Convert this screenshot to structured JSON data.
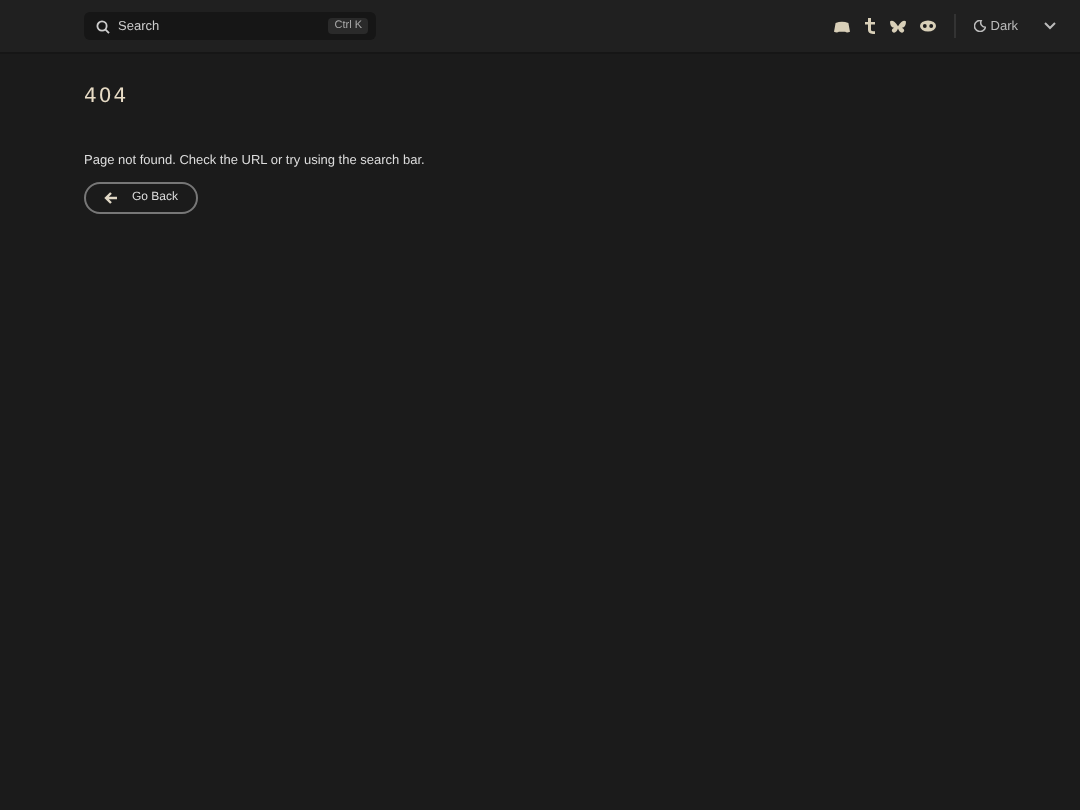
{
  "header": {
    "search": {
      "placeholder": "Search",
      "shortcut": "Ctrl K"
    },
    "theme": {
      "label": "Dark"
    }
  },
  "main": {
    "title": "404",
    "message": "Page not found. Check the URL or try using the search bar.",
    "back_button": "Go Back"
  }
}
